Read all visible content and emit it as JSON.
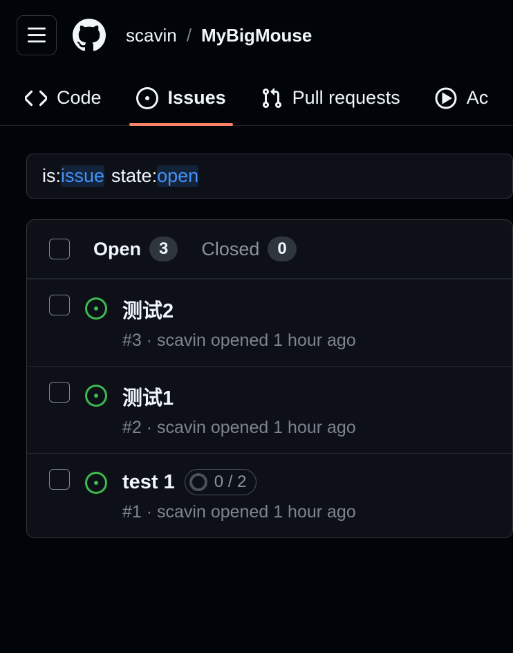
{
  "breadcrumb": {
    "owner": "scavin",
    "repo": "MyBigMouse",
    "sep": "/"
  },
  "tabs": {
    "code": "Code",
    "issues": "Issues",
    "pulls": "Pull requests",
    "actions": "Ac"
  },
  "search": {
    "k1": "is:",
    "v1": "issue",
    "k2": "state:",
    "v2": "open"
  },
  "filters": {
    "open_label": "Open",
    "open_count": "3",
    "closed_label": "Closed",
    "closed_count": "0"
  },
  "issues": [
    {
      "title": "测试2",
      "meta": "#3 · scavin opened 1 hour ago",
      "progress": null
    },
    {
      "title": "测试1",
      "meta": "#2 · scavin opened 1 hour ago",
      "progress": null
    },
    {
      "title": "test 1",
      "meta": "#1 · scavin opened 1 hour ago",
      "progress": "0 / 2"
    }
  ]
}
